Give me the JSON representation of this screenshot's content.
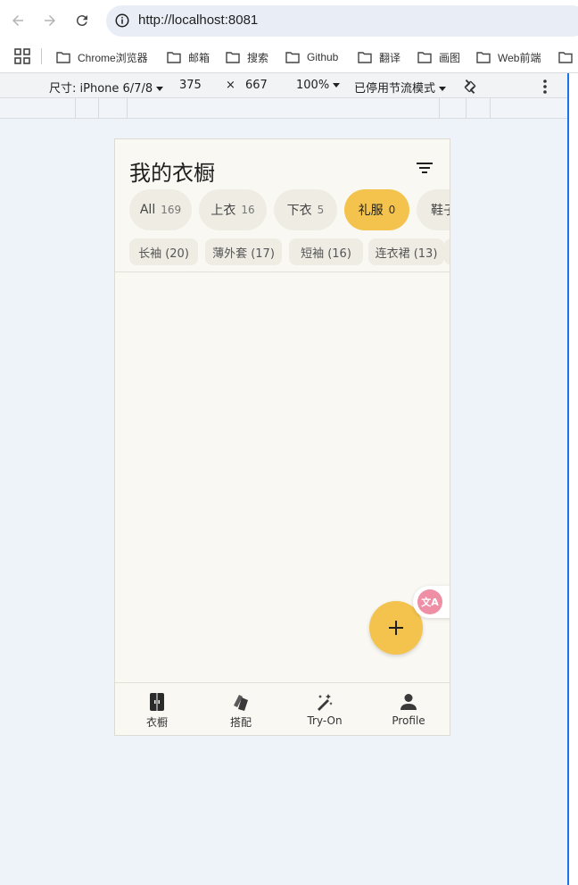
{
  "browser": {
    "url": "http://localhost:8081",
    "bookmarks": [
      "Chrome浏览器",
      "邮箱",
      "搜索",
      "Github",
      "翻译",
      "画图",
      "Web前端"
    ]
  },
  "devtools": {
    "device_label": "尺寸: iPhone 6/7/8",
    "width": "375",
    "times": "×",
    "height": "667",
    "zoom": "100%",
    "throttle": "已停用节流模式"
  },
  "app": {
    "title": "我的衣橱",
    "categories": [
      {
        "label": "All",
        "count": "169",
        "active": false
      },
      {
        "label": "上衣",
        "count": "16",
        "active": false
      },
      {
        "label": "下衣",
        "count": "5",
        "active": false
      },
      {
        "label": "礼服",
        "count": "0",
        "active": true
      },
      {
        "label": "鞋子",
        "count": "",
        "active": false
      }
    ],
    "subcategories": [
      "长袖 (20)",
      "薄外套 (17)",
      "短袖 (16)",
      "连衣裙 (13)"
    ],
    "fab_label": "+",
    "translate_label": "文A",
    "nav": [
      {
        "label": "衣橱",
        "icon": "wardrobe-icon"
      },
      {
        "label": "搭配",
        "icon": "outfit-icon"
      },
      {
        "label": "Try-On",
        "icon": "magic-wand-icon"
      },
      {
        "label": "Profile",
        "icon": "person-icon"
      }
    ],
    "colors": {
      "accent": "#f3c34d",
      "background": "#faf8f3",
      "chip": "#efece3"
    }
  }
}
